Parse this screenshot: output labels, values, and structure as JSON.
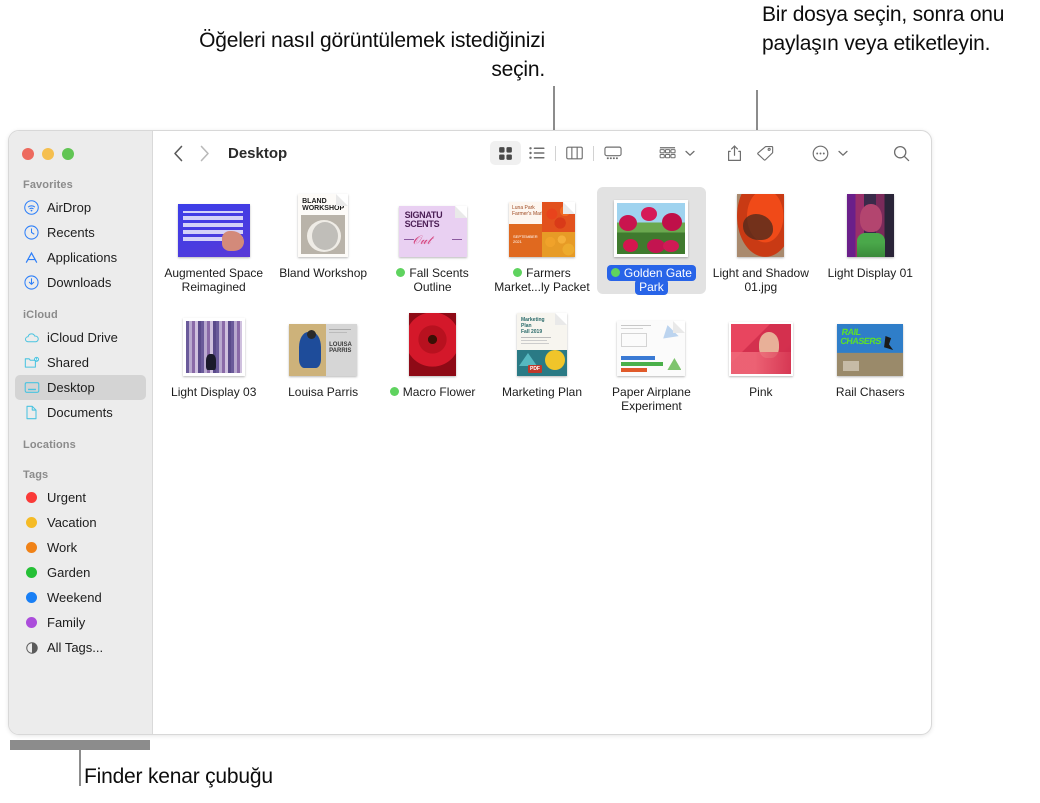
{
  "callouts": {
    "view_modes": "Öğeleri nasıl görüntülemek istediğinizi seçin.",
    "share_tag": "Bir dosya seçin, sonra onu paylaşın veya etiketleyin.",
    "sidebar": "Finder kenar çubuğu"
  },
  "window": {
    "traffic_lights": [
      "close",
      "minimize",
      "zoom"
    ],
    "toolbar": {
      "back_label": "‹",
      "forward_label": "›",
      "title": "Desktop",
      "view_modes": [
        {
          "name": "icon-view",
          "label": "Simge",
          "selected": true
        },
        {
          "name": "list-view",
          "label": "Liste",
          "selected": false
        },
        {
          "name": "column-view",
          "label": "Sütun",
          "selected": false
        },
        {
          "name": "gallery-view",
          "label": "Galeri",
          "selected": false
        }
      ],
      "group_button": "Grupla",
      "share_button": "Paylaş",
      "tag_button": "Etiketle",
      "more_button": "Daha Fazla",
      "search_button": "Ara"
    }
  },
  "sidebar": {
    "sections": [
      {
        "title": "Favorites",
        "items": [
          {
            "label": "AirDrop",
            "icon": "airdrop-icon",
            "selected": false
          },
          {
            "label": "Recents",
            "icon": "clock-icon",
            "selected": false
          },
          {
            "label": "Applications",
            "icon": "applications-icon",
            "selected": false
          },
          {
            "label": "Downloads",
            "icon": "download-icon",
            "selected": false
          }
        ]
      },
      {
        "title": "iCloud",
        "items": [
          {
            "label": "iCloud Drive",
            "icon": "cloud-icon",
            "selected": false
          },
          {
            "label": "Shared",
            "icon": "shared-folder-icon",
            "selected": false
          },
          {
            "label": "Desktop",
            "icon": "desktop-icon",
            "selected": true
          },
          {
            "label": "Documents",
            "icon": "document-icon",
            "selected": false
          }
        ]
      },
      {
        "title": "Locations",
        "items": []
      },
      {
        "title": "Tags",
        "items": [
          {
            "label": "Urgent",
            "icon": "tag-dot-icon",
            "color": "#fa3a38"
          },
          {
            "label": "Vacation",
            "icon": "tag-dot-icon",
            "color": "#f5bb26"
          },
          {
            "label": "Work",
            "icon": "tag-dot-icon",
            "color": "#f08217"
          },
          {
            "label": "Garden",
            "icon": "tag-dot-icon",
            "color": "#25c036"
          },
          {
            "label": "Weekend",
            "icon": "tag-dot-icon",
            "color": "#197ff5"
          },
          {
            "label": "Family",
            "icon": "tag-dot-icon",
            "color": "#ab4ddb"
          },
          {
            "label": "All Tags...",
            "icon": "all-tags-icon",
            "color": ""
          }
        ]
      }
    ]
  },
  "files": [
    {
      "name": "Augmented Space Reimagined",
      "kind": "image",
      "tag": "",
      "selected": false
    },
    {
      "name": "Bland Workshop",
      "kind": "document",
      "tag": "",
      "selected": false
    },
    {
      "name": "Fall Scents Outline",
      "kind": "document",
      "tag": "#5fd35f",
      "selected": false
    },
    {
      "name": "Farmers Market...ly Packet",
      "kind": "document",
      "tag": "#5fd35f",
      "selected": false
    },
    {
      "name": "Golden Gate Park",
      "kind": "image",
      "tag": "#5fd35f",
      "selected": true
    },
    {
      "name": "Light and Shadow 01.jpg",
      "kind": "image",
      "tag": "",
      "selected": false
    },
    {
      "name": "Light Display 01",
      "kind": "image",
      "tag": "",
      "selected": false
    },
    {
      "name": "Light Display 03",
      "kind": "image",
      "tag": "",
      "selected": false
    },
    {
      "name": "Louisa Parris",
      "kind": "image",
      "tag": "",
      "selected": false
    },
    {
      "name": "Macro Flower",
      "kind": "image",
      "tag": "#5fd35f",
      "selected": false
    },
    {
      "name": "Marketing Plan",
      "kind": "pdf",
      "tag": "",
      "selected": false
    },
    {
      "name": "Paper Airplane Experiment",
      "kind": "document",
      "tag": "",
      "selected": false
    },
    {
      "name": "Pink",
      "kind": "image",
      "tag": "",
      "selected": false
    },
    {
      "name": "Rail Chasers",
      "kind": "image",
      "tag": "",
      "selected": false
    }
  ],
  "colors": {
    "selection_blue": "#2864e8",
    "sidebar_bg": "#ececec",
    "selected_row": "#d4d4d4",
    "green_tag": "#5fd35f"
  }
}
